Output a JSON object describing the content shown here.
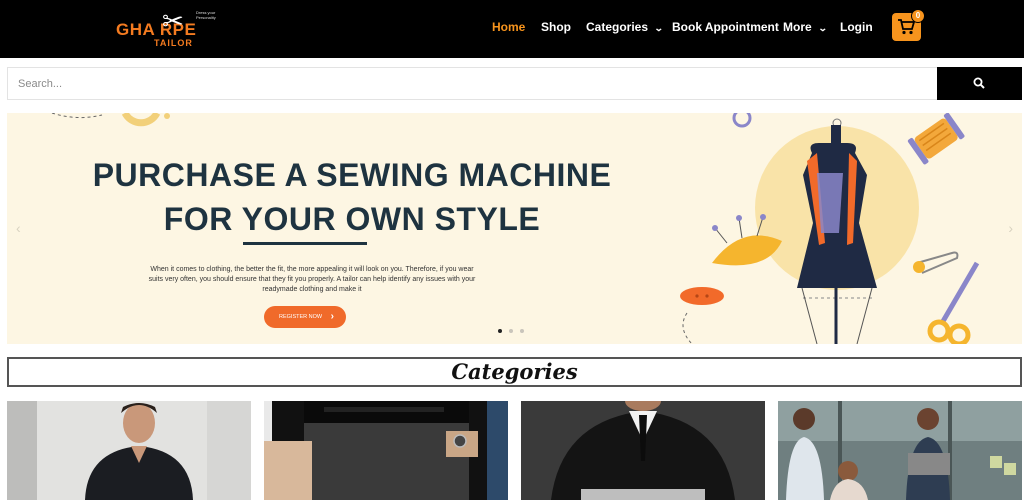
{
  "brand": {
    "logo_text": "GHA  RPE",
    "logo_sub": "TAILOR",
    "logo_tag": "Dress your Personality"
  },
  "nav": {
    "items": [
      {
        "label": "Home",
        "active": true
      },
      {
        "label": "Shop"
      },
      {
        "label": "Categories",
        "dropdown": true
      },
      {
        "label": "Book Appointment"
      },
      {
        "label": "More",
        "dropdown": true
      },
      {
        "label": "Login"
      }
    ],
    "cart_count": "0"
  },
  "search": {
    "placeholder": "Search...",
    "value": ""
  },
  "banner": {
    "title_line1": "PURCHASE A SEWING MACHINE",
    "title_line2": "FOR YOUR OWN STYLE",
    "text": "When it comes to clothing, the better the fit, the more appealing it will look on you. Therefore, if you wear suits very often, you should ensure that they fit you properly. A tailor can help identify any issues with your readymade clothing and make it",
    "cta": "REGISTER NOW",
    "slides": 3,
    "active_slide": 1,
    "colors": {
      "bg": "#fdf6e3",
      "title": "#1e3340",
      "cta": "#f06a2a"
    }
  },
  "categories": {
    "heading": "Categories"
  },
  "colors": {
    "accent": "#f7941d",
    "header_bg": "#000000"
  }
}
